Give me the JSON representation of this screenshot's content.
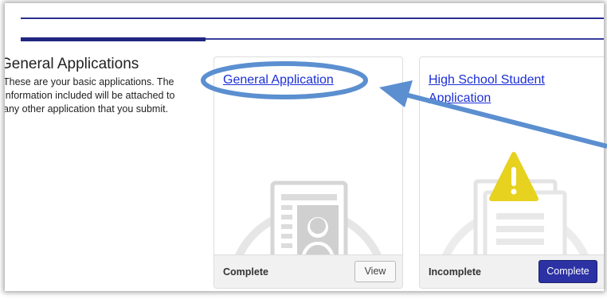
{
  "section": {
    "title": "General Applications",
    "description": [
      "These are your basic applications. The",
      "information included will be attached to",
      "any other application that you submit."
    ]
  },
  "cards": [
    {
      "link": "General Application",
      "status": "Complete",
      "button": "View",
      "icon": "profile-document-icon"
    },
    {
      "link": "High School Student Application",
      "status": "Incomplete",
      "button": "Complete",
      "icon": "warning-document-icon"
    }
  ],
  "colors": {
    "link": "#1c2fd6",
    "header_rule": "#20267f",
    "annotation": "#5b8fd0",
    "warning": "#e6d21f",
    "primary_button": "#2c31a4"
  }
}
